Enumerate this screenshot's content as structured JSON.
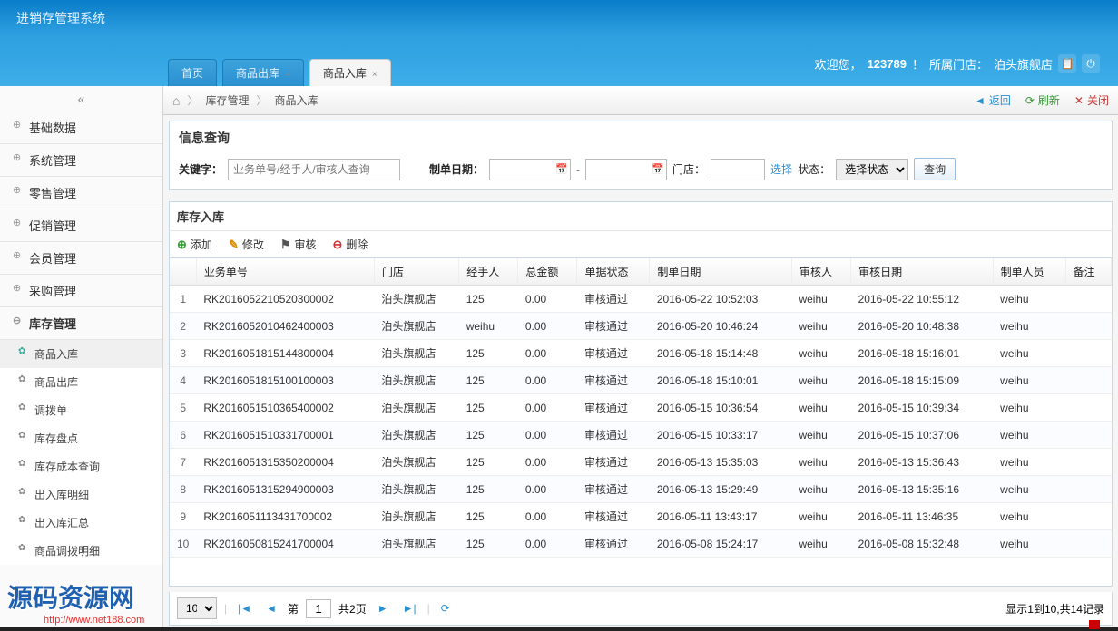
{
  "app_title": "进销存管理系统",
  "welcome": {
    "prefix": "欢迎您，",
    "user": "123789",
    "sep": "！",
    "store_label": "所属门店：",
    "store": "泊头旗舰店"
  },
  "tabs": [
    {
      "label": "首页",
      "closable": false,
      "active": false
    },
    {
      "label": "商品出库",
      "closable": true,
      "active": false
    },
    {
      "label": "商品入库",
      "closable": true,
      "active": true
    }
  ],
  "nav": {
    "collapse_glyph": "«",
    "groups": [
      {
        "label": "基础数据"
      },
      {
        "label": "系统管理"
      },
      {
        "label": "零售管理"
      },
      {
        "label": "促销管理"
      },
      {
        "label": "会员管理"
      },
      {
        "label": "采购管理"
      },
      {
        "label": "库存管理",
        "expanded": true,
        "items": [
          {
            "label": "商品入库",
            "active": true
          },
          {
            "label": "商品出库"
          },
          {
            "label": "调拨单"
          },
          {
            "label": "库存盘点"
          },
          {
            "label": "库存成本查询"
          },
          {
            "label": "出入库明细"
          },
          {
            "label": "出入库汇总"
          },
          {
            "label": "商品调拨明细"
          }
        ]
      }
    ]
  },
  "breadcrumb": {
    "home": "⌂",
    "lvl1": "库存管理",
    "lvl2": "商品入库",
    "back": "返回",
    "refresh": "刷新",
    "close": "关闭"
  },
  "search": {
    "panel_title": "信息查询",
    "kw_label": "关键字：",
    "kw_placeholder": "业务单号/经手人/审核人查询",
    "date_label": "制单日期：",
    "store_label": "门店：",
    "choose": "选择",
    "status_label": "状态：",
    "status_value": "选择状态",
    "query_btn": "查询"
  },
  "grid": {
    "section_title": "库存入库",
    "toolbar": {
      "add": "添加",
      "edit": "修改",
      "audit": "审核",
      "del": "删除"
    },
    "columns": [
      "业务单号",
      "门店",
      "经手人",
      "总金额",
      "单据状态",
      "制单日期",
      "审核人",
      "审核日期",
      "制单人员",
      "备注"
    ],
    "rows": [
      {
        "no": "RK2016052210520300002",
        "store": "泊头旗舰店",
        "handler": "125",
        "amount": "0.00",
        "status": "审核通过",
        "make": "2016-05-22 10:52:03",
        "auditor": "weihu",
        "audit": "2016-05-22 10:55:12",
        "maker": "weihu",
        "remark": ""
      },
      {
        "no": "RK2016052010462400003",
        "store": "泊头旗舰店",
        "handler": "weihu",
        "amount": "0.00",
        "status": "审核通过",
        "make": "2016-05-20 10:46:24",
        "auditor": "weihu",
        "audit": "2016-05-20 10:48:38",
        "maker": "weihu",
        "remark": ""
      },
      {
        "no": "RK2016051815144800004",
        "store": "泊头旗舰店",
        "handler": "125",
        "amount": "0.00",
        "status": "审核通过",
        "make": "2016-05-18 15:14:48",
        "auditor": "weihu",
        "audit": "2016-05-18 15:16:01",
        "maker": "weihu",
        "remark": ""
      },
      {
        "no": "RK2016051815100100003",
        "store": "泊头旗舰店",
        "handler": "125",
        "amount": "0.00",
        "status": "审核通过",
        "make": "2016-05-18 15:10:01",
        "auditor": "weihu",
        "audit": "2016-05-18 15:15:09",
        "maker": "weihu",
        "remark": ""
      },
      {
        "no": "RK2016051510365400002",
        "store": "泊头旗舰店",
        "handler": "125",
        "amount": "0.00",
        "status": "审核通过",
        "make": "2016-05-15 10:36:54",
        "auditor": "weihu",
        "audit": "2016-05-15 10:39:34",
        "maker": "weihu",
        "remark": ""
      },
      {
        "no": "RK2016051510331700001",
        "store": "泊头旗舰店",
        "handler": "125",
        "amount": "0.00",
        "status": "审核通过",
        "make": "2016-05-15 10:33:17",
        "auditor": "weihu",
        "audit": "2016-05-15 10:37:06",
        "maker": "weihu",
        "remark": ""
      },
      {
        "no": "RK2016051315350200004",
        "store": "泊头旗舰店",
        "handler": "125",
        "amount": "0.00",
        "status": "审核通过",
        "make": "2016-05-13 15:35:03",
        "auditor": "weihu",
        "audit": "2016-05-13 15:36:43",
        "maker": "weihu",
        "remark": ""
      },
      {
        "no": "RK2016051315294900003",
        "store": "泊头旗舰店",
        "handler": "125",
        "amount": "0.00",
        "status": "审核通过",
        "make": "2016-05-13 15:29:49",
        "auditor": "weihu",
        "audit": "2016-05-13 15:35:16",
        "maker": "weihu",
        "remark": ""
      },
      {
        "no": "RK2016051113431700002",
        "store": "泊头旗舰店",
        "handler": "125",
        "amount": "0.00",
        "status": "审核通过",
        "make": "2016-05-11 13:43:17",
        "auditor": "weihu",
        "audit": "2016-05-11 13:46:35",
        "maker": "weihu",
        "remark": ""
      },
      {
        "no": "RK2016050815241700004",
        "store": "泊头旗舰店",
        "handler": "125",
        "amount": "0.00",
        "status": "审核通过",
        "make": "2016-05-08 15:24:17",
        "auditor": "weihu",
        "audit": "2016-05-08 15:32:48",
        "maker": "weihu",
        "remark": ""
      }
    ]
  },
  "pager": {
    "page_size": "10",
    "page_label_pre": "第",
    "page_value": "1",
    "page_total": "共2页",
    "summary": "显示1到10,共14记录"
  },
  "watermark": {
    "text": "源码资源网",
    "url": "http://www.net188.com"
  }
}
